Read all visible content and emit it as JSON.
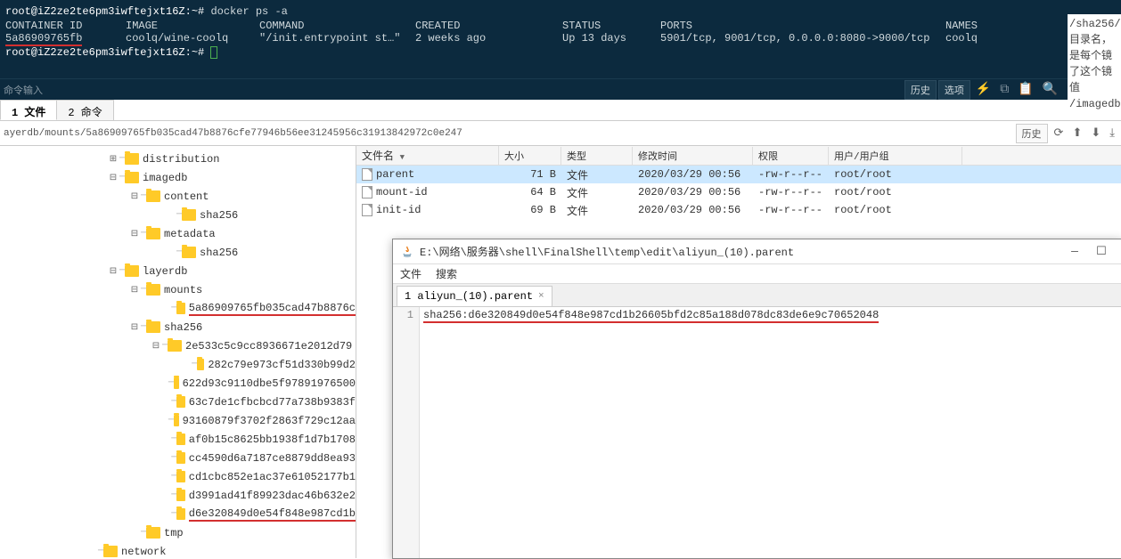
{
  "terminal": {
    "prompt": "root@iZ2ze2te6pm3iwftejxt16Z:~#",
    "cmd": " docker ps -a",
    "headers": [
      "CONTAINER ID",
      "IMAGE",
      "COMMAND",
      "CREATED",
      "STATUS",
      "PORTS",
      "NAMES"
    ],
    "row": [
      "5a86909765fb",
      "coolq/wine-coolq",
      "\"/init.entrypoint st…\"",
      "2 weeks ago",
      "Up 13 days",
      "5901/tcp, 9001/tcp, 0.0.0.0:8080->9000/tcp",
      "coolq"
    ]
  },
  "toolbar": {
    "input_label": "命令输入",
    "history": "历史",
    "options": "选项"
  },
  "tabs": {
    "files": "1 文件",
    "cmds": "2 命令"
  },
  "path": {
    "text": "ayerdb/mounts/5a86909765fb035cad47b8876cfe77946b56ee31245956c31913842972c0e247",
    "history": "历史"
  },
  "tree": [
    {
      "indent": 120,
      "toggle": "⊞",
      "label": "distribution"
    },
    {
      "indent": 120,
      "toggle": "⊟",
      "label": "imagedb"
    },
    {
      "indent": 144,
      "toggle": "⊟",
      "label": "content"
    },
    {
      "indent": 184,
      "toggle": "",
      "label": "sha256"
    },
    {
      "indent": 144,
      "toggle": "⊟",
      "label": "metadata"
    },
    {
      "indent": 184,
      "toggle": "",
      "label": "sha256"
    },
    {
      "indent": 120,
      "toggle": "⊟",
      "label": "layerdb"
    },
    {
      "indent": 144,
      "toggle": "⊟",
      "label": "mounts"
    },
    {
      "indent": 184,
      "toggle": "",
      "label": "5a86909765fb035cad47b8876c",
      "underline": true
    },
    {
      "indent": 144,
      "toggle": "⊟",
      "label": "sha256"
    },
    {
      "indent": 168,
      "toggle": "⊟",
      "label": "2e533c5c9cc8936671e2012d79"
    },
    {
      "indent": 208,
      "toggle": "",
      "label": "282c79e973cf51d330b99d2"
    },
    {
      "indent": 184,
      "toggle": "",
      "label": "622d93c9110dbe5f97891976500"
    },
    {
      "indent": 184,
      "toggle": "",
      "label": "63c7de1cfbcbcd77a738b9383f"
    },
    {
      "indent": 184,
      "toggle": "",
      "label": "93160879f3702f2863f729c12aa"
    },
    {
      "indent": 184,
      "toggle": "",
      "label": "af0b15c8625bb1938f1d7b1708"
    },
    {
      "indent": 184,
      "toggle": "",
      "label": "cc4590d6a7187ce8879dd8ea93"
    },
    {
      "indent": 184,
      "toggle": "",
      "label": "cd1cbc852e1ac37e61052177b1"
    },
    {
      "indent": 184,
      "toggle": "",
      "label": "d3991ad41f89923dac46b632e2"
    },
    {
      "indent": 184,
      "toggle": "",
      "label": "d6e320849d0e54f848e987cd1b",
      "underline": true
    },
    {
      "indent": 144,
      "toggle": "",
      "label": "tmp"
    },
    {
      "indent": 96,
      "toggle": "",
      "label": "network"
    }
  ],
  "file_headers": {
    "name": "文件名",
    "size": "大小",
    "type": "类型",
    "date": "修改时间",
    "perm": "权限",
    "owner": "用户/用户组"
  },
  "files": [
    {
      "name": "parent",
      "size": "71 B",
      "type": "文件",
      "date": "2020/03/29 00:56",
      "perm": "-rw-r--r--",
      "owner": "root/root",
      "selected": true
    },
    {
      "name": "mount-id",
      "size": "64 B",
      "type": "文件",
      "date": "2020/03/29 00:56",
      "perm": "-rw-r--r--",
      "owner": "root/root"
    },
    {
      "name": "init-id",
      "size": "69 B",
      "type": "文件",
      "date": "2020/03/29 00:56",
      "perm": "-rw-r--r--",
      "owner": "root/root"
    }
  ],
  "editor": {
    "title": "E:\\网络\\服务器\\shell\\FinalShell\\temp\\edit\\aliyun_(10).parent",
    "menu": {
      "file": "文件",
      "search": "搜索"
    },
    "tab": "1 aliyun_(10).parent",
    "line_num": "1",
    "content": "sha256:d6e320849d0e54f848e987cd1b26605bfd2c85a188d078dc83de6e9c70652048"
  },
  "side": "/sha256/\n目录名，\n\n是每个镜\n了这个镜值\n/imagedb"
}
